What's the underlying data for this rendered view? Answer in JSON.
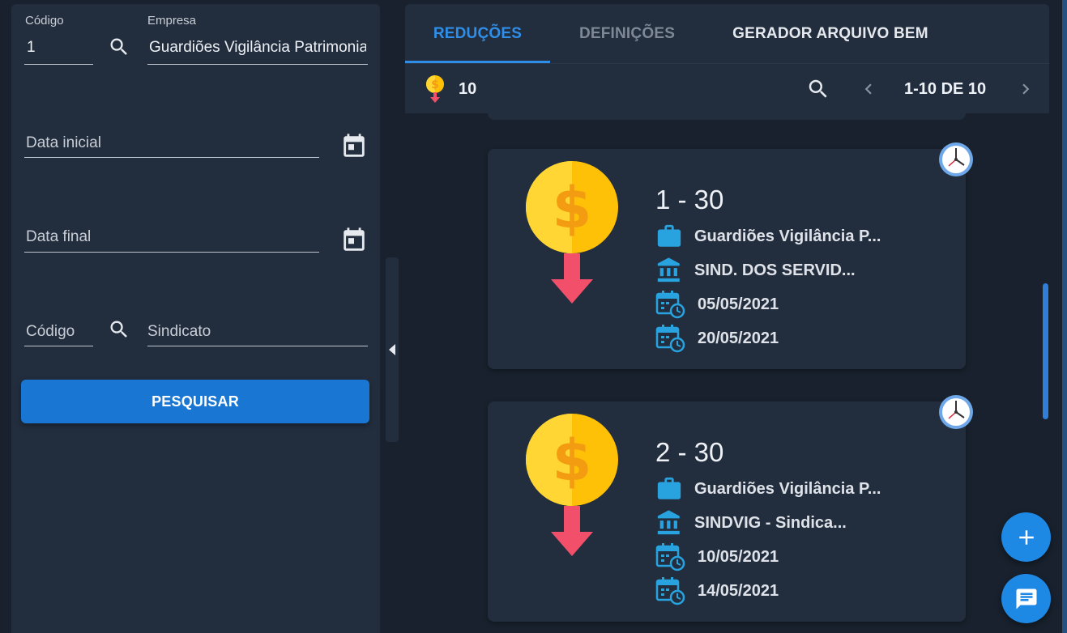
{
  "filters": {
    "empresa_codigo_label": "Código",
    "empresa_codigo_value": "1",
    "empresa_label": "Empresa",
    "empresa_value": "Guardiões Vigilância Patrimonial",
    "data_inicial_placeholder": "Data inicial",
    "data_final_placeholder": "Data final",
    "sindicato_codigo_placeholder": "Código",
    "sindicato_placeholder": "Sindicato",
    "search_button_label": "PESQUISAR"
  },
  "tabs": [
    {
      "label": "REDUÇÕES",
      "state": "active"
    },
    {
      "label": "DEFINIÇÕES",
      "state": "disabled"
    },
    {
      "label": "GERADOR ARQUIVO BEM",
      "state": "normal"
    }
  ],
  "toolbar": {
    "count": "10",
    "pager": "1-10 DE 10"
  },
  "cards": [
    {
      "title": "1 - 30",
      "empresa": "Guardiões Vigilância P...",
      "sindicato": "SIND. DOS SERVID...",
      "data_inicial": "05/05/2021",
      "data_final": "20/05/2021"
    },
    {
      "title": "2 - 30",
      "empresa": "Guardiões Vigilância P...",
      "sindicato": "SINDVIG - Sindica...",
      "data_inicial": "10/05/2021",
      "data_final": "14/05/2021"
    }
  ],
  "colors": {
    "accent": "#2f8fe8",
    "primary_button": "#1976d2",
    "panel": "#222e3e",
    "background": "#18212d",
    "icon_blue": "#29a3e0",
    "coin_yellow": "#ffc107",
    "arrow_red": "#f2506a"
  },
  "icons": {
    "empresa_search": "search-icon",
    "date_picker": "calendar-icon",
    "card_company": "briefcase-icon",
    "card_union": "bank-icon",
    "card_date": "calendar-clock-icon",
    "card_status": "clock-icon",
    "add": "plus-icon",
    "chat": "chat-icon"
  }
}
